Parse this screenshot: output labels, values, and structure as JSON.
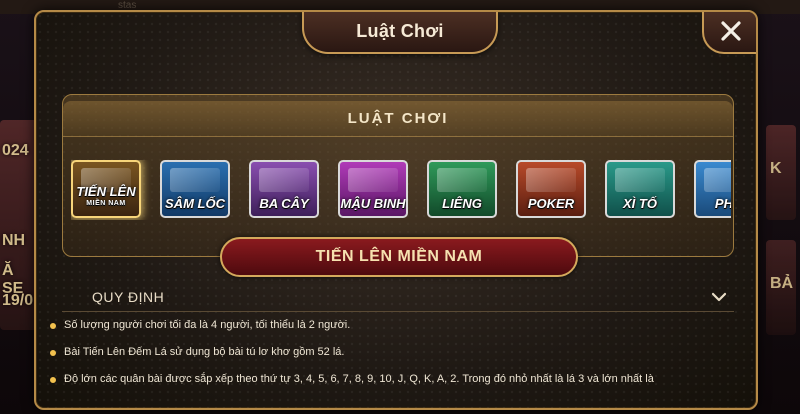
{
  "background": {
    "top_text": "stas",
    "left_card_lines": [
      "024",
      "NH",
      "Ă SE",
      "19/0"
    ],
    "right_card_1": "K",
    "right_card_2": "BẢ"
  },
  "modal": {
    "title": "Luật Chơi",
    "close_label": "✕"
  },
  "panel": {
    "title": "LUẬT CHƠI",
    "games": [
      {
        "label": "TIẾN LÊN",
        "sub": "MIỀN NAM",
        "active": true
      },
      {
        "label": "SÂM LỐC",
        "sub": ""
      },
      {
        "label": "BA CÂY",
        "sub": ""
      },
      {
        "label": "MẬU BINH",
        "sub": ""
      },
      {
        "label": "LIÊNG",
        "sub": ""
      },
      {
        "label": "POKER",
        "sub": ""
      },
      {
        "label": "XÌ TỐ",
        "sub": ""
      },
      {
        "label": "PHỎ",
        "sub": ""
      }
    ]
  },
  "selected_game": "TIẾN LÊN MIỀN NAM",
  "section": {
    "title": "QUY ĐỊNH"
  },
  "rules": [
    "Số lượng người chơi tối đa là 4 người, tối thiểu là 2 người.",
    "Bài Tiến Lên Đếm Lá sử dụng bộ bài tú lơ khơ gồm 52 lá.",
    "Độ lớn các quân bài được sắp xếp theo thứ tự 3, 4, 5, 6, 7, 8, 9, 10, J, Q, K, A, 2. Trong đó nhỏ nhất là lá 3 và lớn nhất là"
  ],
  "colors": {
    "accent_gold": "#c79a55",
    "selected_red": "#8a1a1e",
    "bullet": "#f2c14e"
  }
}
